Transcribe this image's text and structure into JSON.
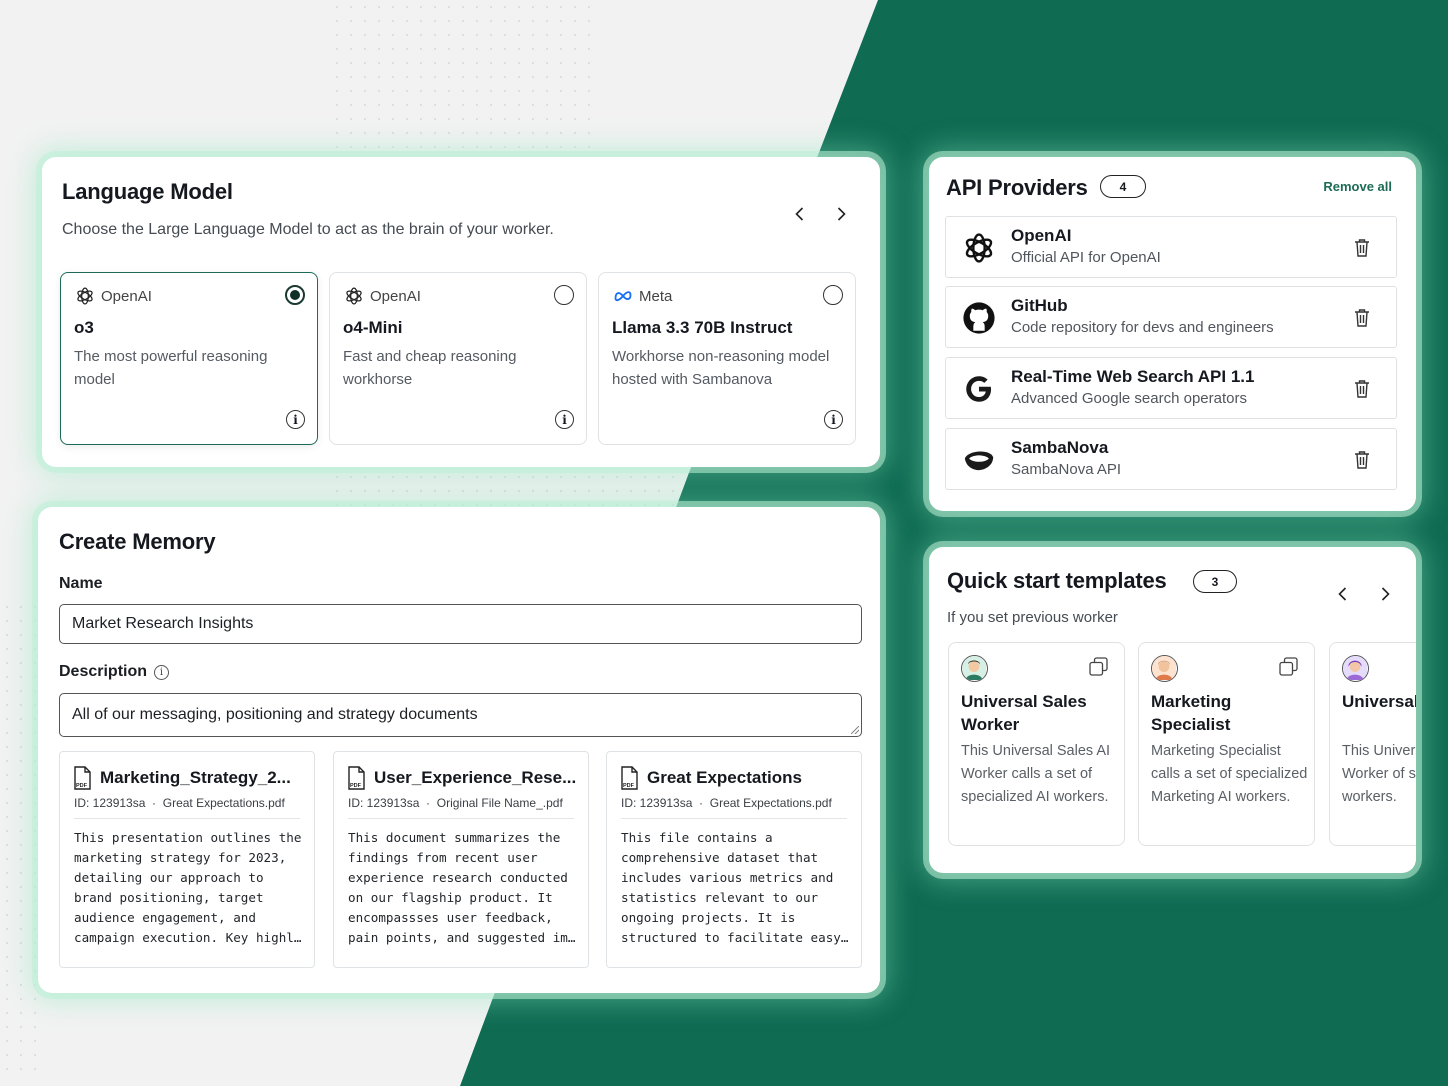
{
  "language_model": {
    "title": "Language Model",
    "subtitle": "Choose the Large Language Model to act as the brain of your worker.",
    "models": [
      {
        "provider": "OpenAI",
        "provider_icon": "openai-icon",
        "name": "o3",
        "description": "The most powerful reasoning model",
        "selected": true
      },
      {
        "provider": "OpenAI",
        "provider_icon": "openai-icon",
        "name": "o4-Mini",
        "description": "Fast and cheap reasoning workhorse",
        "selected": false
      },
      {
        "provider": "Meta",
        "provider_icon": "meta-icon",
        "name": "Llama 3.3 70B Instruct",
        "description": "Workhorse non-reasoning model hosted with Sambanova",
        "selected": false
      }
    ]
  },
  "create_memory": {
    "title": "Create Memory",
    "name_label": "Name",
    "name_value": "Market Research Insights",
    "description_label": "Description",
    "description_value": "All of our messaging, positioning and strategy documents",
    "documents": [
      {
        "title": "Marketing_Strategy_2...",
        "id": "ID:  123913sa",
        "file": "Great Expectations.pdf",
        "body": "This presentation outlines the marketing strategy for 2023, detailing our approach to brand positioning, target audience engagement, and campaign execution. Key highl…"
      },
      {
        "title": "User_Experience_Rese...",
        "id": "ID:  123913sa",
        "file": "Original File Name_.pdf",
        "body": "This document summarizes the findings from recent user experience research conducted on our flagship product. It encompassses user feedback, pain points, and suggested im…"
      },
      {
        "title": "Great Expectations",
        "id": "ID:  123913sa",
        "file": "Great Expectations.pdf",
        "body": "This file contains a comprehensive dataset that includes various metrics and statistics relevant to our ongoing projects. It is structured to facilitate easy…"
      }
    ]
  },
  "api_providers": {
    "title": "API Providers",
    "count": "4",
    "remove_all": "Remove all",
    "items": [
      {
        "name": "OpenAI",
        "description": "Official API for OpenAI",
        "icon": "openai-icon"
      },
      {
        "name": "GitHub",
        "description": "Code repository for devs and engineers",
        "icon": "github-icon"
      },
      {
        "name": "Real-Time Web Search API 1.1",
        "description": "Advanced Google search operators",
        "icon": "google-icon"
      },
      {
        "name": "SambaNova",
        "description": "SambaNova API",
        "icon": "sambanova-icon"
      }
    ]
  },
  "quick_start": {
    "title": "Quick start templates",
    "count": "3",
    "subtitle": "If you set previous worker",
    "templates": [
      {
        "name": "Universal Sales Worker",
        "description": "This Universal Sales AI Worker calls a set of specialized AI workers."
      },
      {
        "name": "Marketing Specialist",
        "description": "Marketing Specialist calls a set of specialized Marketing AI workers."
      },
      {
        "name": "Universal Worker",
        "description": "This Universal AI Worker of specialized workers."
      }
    ]
  },
  "colors": {
    "brand_green": "#0f6b52",
    "accent": "#1d6b56"
  }
}
